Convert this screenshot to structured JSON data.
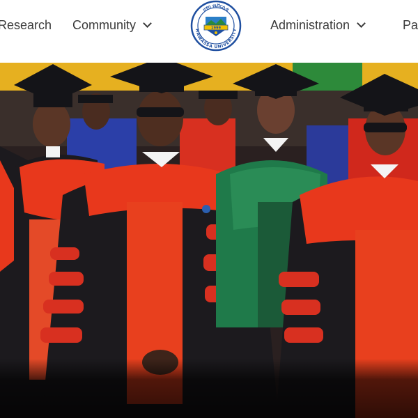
{
  "nav": {
    "items": [
      {
        "label": "Research",
        "has_dropdown": false
      },
      {
        "label": "Community",
        "has_dropdown": true
      },
      {
        "label": "Administration",
        "has_dropdown": true
      },
      {
        "label": "Pa",
        "has_dropdown": false
      }
    ]
  },
  "logo": {
    "top_text": "ሀዋሳ ዩኒቨርሲቲ",
    "bottom_text": "HAWASSA UNIVERSITY",
    "banner_text": "1999",
    "colors": {
      "ring": "#1f4fa0",
      "banner": "#f2c200",
      "accent": "#2a8a3a"
    }
  },
  "hero": {
    "icon": "graduation-photo",
    "colors": {
      "gown_red": "#e8381c",
      "gown_black": "#1c1a1e",
      "hood_green": "#1f7a4a",
      "cap": "#141418",
      "skin": "#5a3626"
    }
  }
}
